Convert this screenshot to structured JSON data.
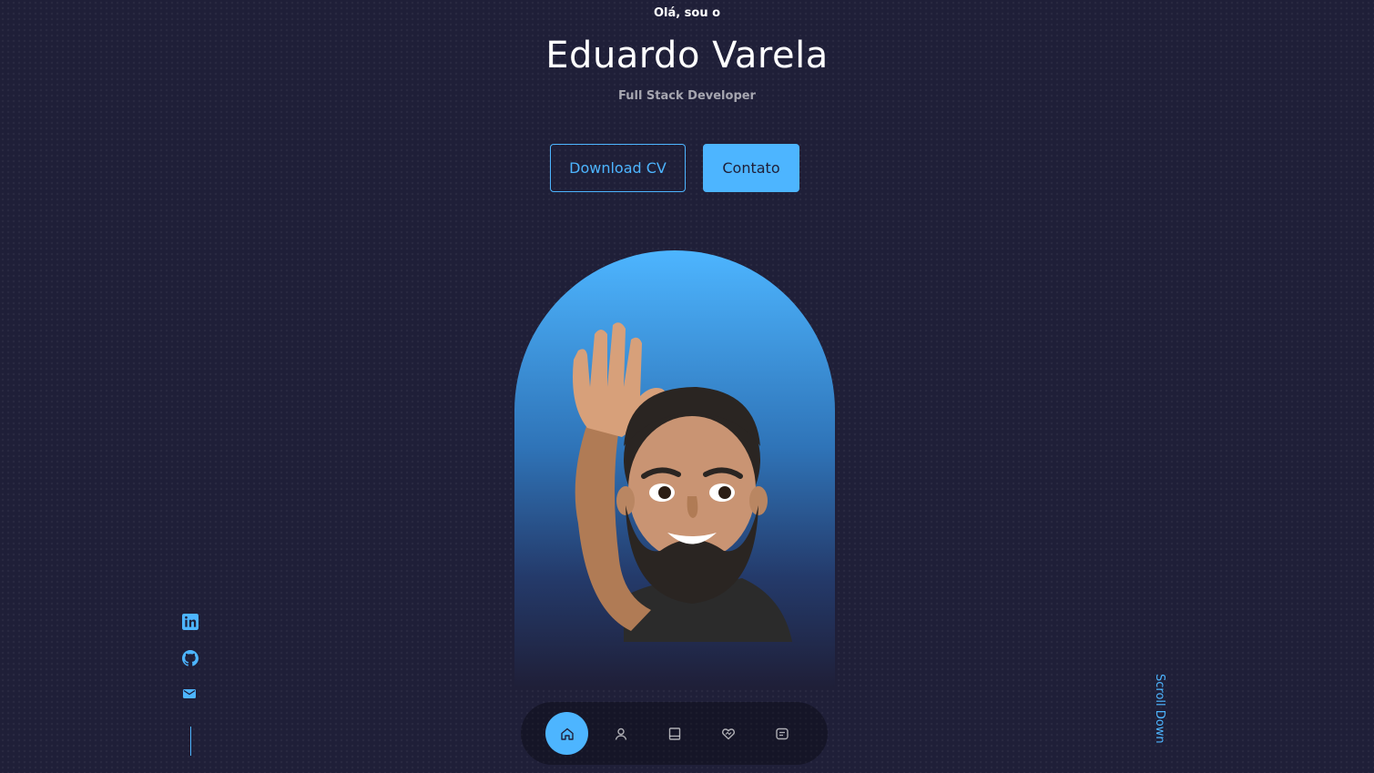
{
  "header": {
    "greeting": "Olá, sou o",
    "name": "Eduardo Varela",
    "role": "Full Stack Developer"
  },
  "cta": {
    "download_label": "Download CV",
    "contact_label": "Contato"
  },
  "socials": [
    {
      "icon": "linkedin-icon"
    },
    {
      "icon": "github-icon"
    },
    {
      "icon": "mail-icon"
    }
  ],
  "scroll_down": "Scroll Down",
  "nav": [
    {
      "icon": "home-icon",
      "active": true
    },
    {
      "icon": "user-icon",
      "active": false
    },
    {
      "icon": "book-icon",
      "active": false
    },
    {
      "icon": "services-icon",
      "active": false
    },
    {
      "icon": "message-icon",
      "active": false
    }
  ],
  "colors": {
    "background": "#1f1f38",
    "accent": "#4db5ff",
    "text": "#ffffff"
  }
}
